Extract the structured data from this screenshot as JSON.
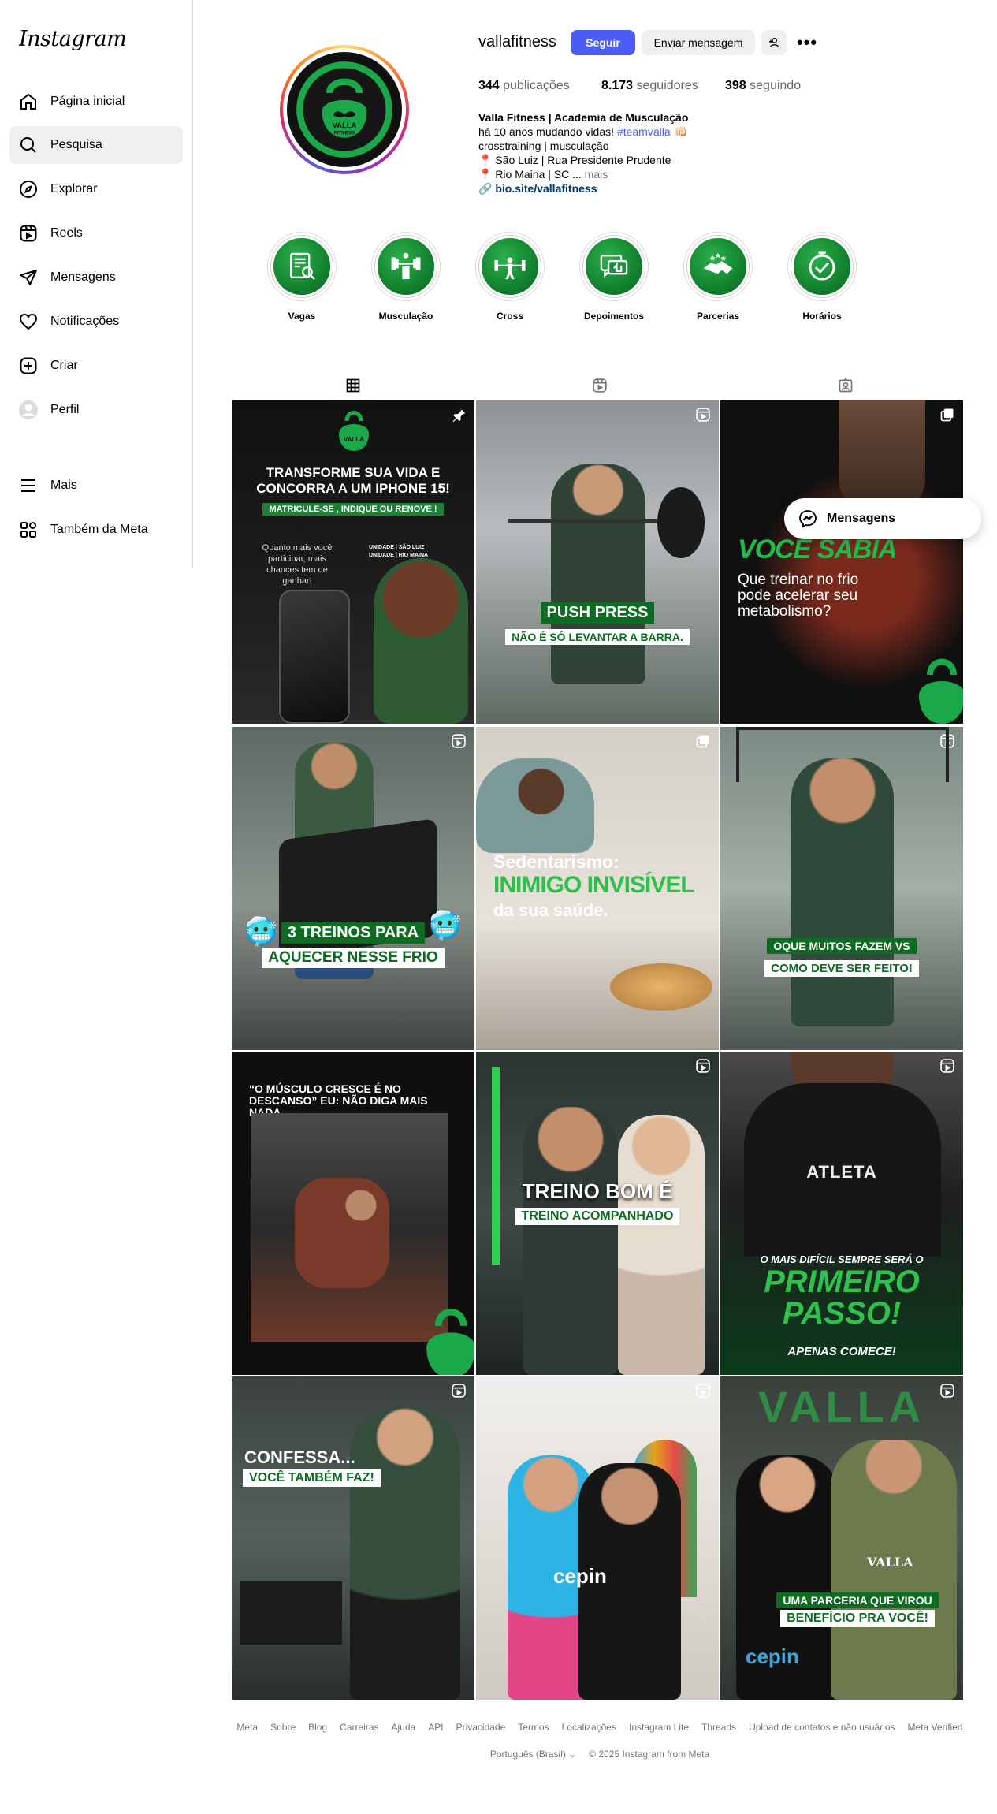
{
  "sidebar": {
    "logo": "Instagram",
    "items": [
      {
        "label": "Página inicial",
        "icon": "home-icon"
      },
      {
        "label": "Pesquisa",
        "icon": "search-icon"
      },
      {
        "label": "Explorar",
        "icon": "compass-icon"
      },
      {
        "label": "Reels",
        "icon": "reels-icon"
      },
      {
        "label": "Mensagens",
        "icon": "send-icon"
      },
      {
        "label": "Notificações",
        "icon": "heart-icon"
      },
      {
        "label": "Criar",
        "icon": "plus-square-icon"
      },
      {
        "label": "Perfil",
        "icon": "avatar-icon"
      },
      {
        "label": "Mais",
        "icon": "menu-icon"
      },
      {
        "label": "Também da Meta",
        "icon": "meta-apps-icon"
      }
    ]
  },
  "profile": {
    "username": "vallafitness",
    "follow_label": "Seguir",
    "message_label": "Enviar mensagem",
    "more_label": "•••",
    "stats": {
      "posts_value": "344",
      "posts_label": " publicações",
      "followers_value": "8.173",
      "followers_label": " seguidores",
      "following_value": "398",
      "following_label": " seguindo"
    },
    "bio": {
      "name": "Valla Fitness | Academia de Musculação",
      "line1": "há 10 anos mudando vidas! ",
      "hashtag": "#teamvalla",
      "line1_emoji": " 👊🏻",
      "line2": "crosstraining | musculação",
      "line3": "📍 São Luiz | Rua Presidente Prudente",
      "line4": "📍 Rio Maina | SC ...",
      "more": " mais",
      "link": "bio.site/vallafitness"
    }
  },
  "highlights": [
    {
      "label": "Vagas",
      "icon": "job-search-icon"
    },
    {
      "label": "Musculação",
      "icon": "dumbbell-icon"
    },
    {
      "label": "Cross",
      "icon": "weightlifter-icon"
    },
    {
      "label": "Depoimentos",
      "icon": "testimonial-icon"
    },
    {
      "label": "Parcerias",
      "icon": "handshake-icon"
    },
    {
      "label": "Horários",
      "icon": "clock-icon"
    }
  ],
  "tabs": [
    {
      "name": "posts",
      "icon": "grid-icon"
    },
    {
      "name": "reels",
      "icon": "reels-icon"
    },
    {
      "name": "tagged",
      "icon": "tagged-icon"
    }
  ],
  "posts": {
    "p1": {
      "title": "TRANSFORME SUA VIDA E CONCORRA A UM IPHONE 15!",
      "sub": "MATRICULE-SE , INDIQUE OU RENOVE !",
      "side": "Quanto mais você participar, mais chances tem de ganhar!",
      "loc": "UNIDADE | SÃO LUIZ UNIDADE | RIO MAINA"
    },
    "p2": {
      "title": "PUSH PRESS",
      "sub": "NÃO É SÓ LEVANTAR A BARRA."
    },
    "p3": {
      "title": "VOCÊ SABIA",
      "sub": "Que treinar no frio pode acelerar seu metabolismo?"
    },
    "p4": {
      "title": "3 TREINOS PARA",
      "sub": "AQUECER NESSE FRIO"
    },
    "p5": {
      "title": "Sedentarismo:",
      "mid": "INIMIGO INVISÍVEL",
      "sub": "da sua saúde."
    },
    "p6": {
      "title": "OQUE MUITOS FAZEM VS",
      "sub": "COMO DEVE SER FEITO!"
    },
    "p7": {
      "title": "“O MÚSCULO CRESCE É NO DESCANSO” EU: NÃO DIGA MAIS NADA."
    },
    "p8": {
      "title": "TREINO BOM É",
      "sub": "TREINO ACOMPANHADO"
    },
    "p9": {
      "shirt": "ATLETA",
      "title": "O MAIS DIFÍCIL SEMPRE SERÁ O",
      "mid": "PRIMEIRO PASSO!",
      "sub": "APENAS COMECE!"
    },
    "p10": {
      "title": "CONFESSA...",
      "sub": "VOCÊ TAMBÉM FAZ!"
    },
    "p11": {
      "brand": "cepin"
    },
    "p12": {
      "wall": "VALLA",
      "shirt": "VALLA",
      "title": "UMA PARCERIA QUE VIROU",
      "sub": "BENEFÍCIO PRA VOCÊ!",
      "brand": "cepin"
    }
  },
  "floating": {
    "label": "Mensagens"
  },
  "footer": {
    "links": [
      "Meta",
      "Sobre",
      "Blog",
      "Carreiras",
      "Ajuda",
      "API",
      "Privacidade",
      "Termos",
      "Localizações",
      "Instagram Lite",
      "Threads",
      "Upload de contatos e não usuários",
      "Meta Verified"
    ],
    "language": "Português (Brasil) ⌄",
    "copyright": "© 2025 Instagram from Meta"
  }
}
